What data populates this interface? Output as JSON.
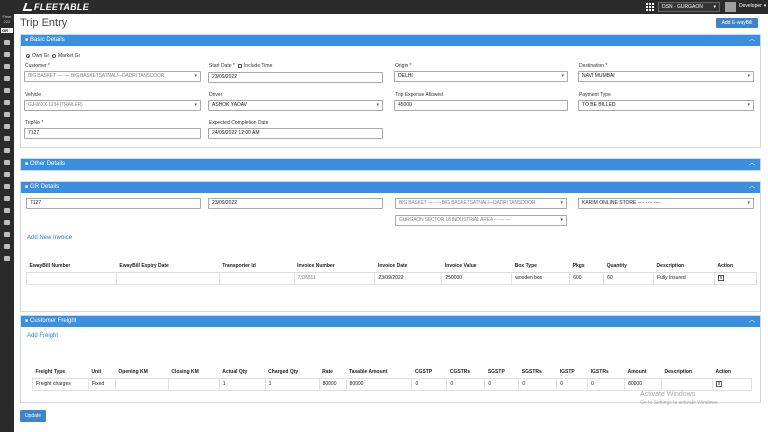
{
  "topbar": {
    "logo": "FLEETABLE",
    "branch": "DSN - GURGAON",
    "user": "Developer"
  },
  "sidebar": {
    "header_lines": [
      "Fleet",
      "222"
    ],
    "badge": "GR"
  },
  "page": {
    "title": "Trip Entry",
    "add_eway_label": "Add E-wayBill",
    "update_label": "Update"
  },
  "basic": {
    "header": "Basic Details",
    "own_gr": "Own Gr",
    "market_gr": "Market Gr",
    "customer_label": "Customer *",
    "customer_value": "BIG BASKET ---- ---- BIG BASKETSATNALI---DADRI TANSDOOR",
    "start_date_label": "Start Date *",
    "include_time_label": "Include Time",
    "start_date_value": "23/09/2022",
    "origin_label": "Origin *",
    "origin_value": "DELHI",
    "destination_label": "Destination *",
    "destination_value": "NAVI MUMBAI",
    "vehicle_label": "Vehicle",
    "vehicle_value": "GJ-06XX-1234 (TRAILER)",
    "driver_label": "Driver",
    "driver_value": "ASHOK YADAV",
    "expense_label": "Trip Expense Allowed",
    "expense_value": "45000",
    "payment_label": "Payment Type",
    "payment_value": "TO BE BILLED",
    "tripno_label": "TripNo *",
    "tripno_value": "7127",
    "completion_label": "Expected Completion Date",
    "completion_value": "24/09/2022 12:00 AM"
  },
  "other": {
    "header": "Other Details"
  },
  "gr": {
    "header": "GR Details",
    "gr_no": "7127",
    "gr_date": "23/09/2022",
    "consignor": "BIG BASKET ---- ---- BIG BASKETSATNALI---DADRI TANSDOOR",
    "consignee": "KARIM ONLINE STORE ---- ---- ----",
    "address": "GURGAON SECTOR 18 INDUSTRIAL AREA -- ---- ----",
    "add_invoice": "Add New Invoice",
    "columns": [
      "EwayBill Number",
      "EwayBill Expiry Date",
      "Transporter Id",
      "Invoice Number",
      "Invoice Date",
      "Invoice Value",
      "Box Type",
      "Pkgs",
      "Quantity",
      "Description",
      "Action"
    ],
    "row": [
      "",
      "",
      "",
      "7335511",
      "23/09/2022",
      "250000",
      "wooden box",
      "600",
      "60",
      "Fully Insured",
      "x"
    ]
  },
  "freight": {
    "header": "Customer Freight",
    "add_freight": "Add Freight",
    "columns": [
      "Freight Type",
      "Unit",
      "Opening KM",
      "Closing KM",
      "Actual Qty",
      "Charged Qty",
      "Rate",
      "Taxable Amount",
      "CGSTP",
      "CGSTRs",
      "SGSTP",
      "SGSTRs",
      "IGSTP",
      "IGSTRs",
      "Amount",
      "Description",
      "Action"
    ],
    "row": [
      "Freight charges",
      "Fixed",
      "",
      "",
      "1",
      "1",
      "80000",
      "80000",
      "0",
      "0",
      "0",
      "0",
      "0",
      "0",
      "80000",
      "",
      "x"
    ]
  },
  "watermark": {
    "line1": "Activate Windows",
    "line2": "Go to Settings to activate Windows."
  },
  "colors": {
    "header_blue": "#3b8fe0",
    "button_blue": "#3d85c6",
    "topbar": "#2b2b2b"
  }
}
